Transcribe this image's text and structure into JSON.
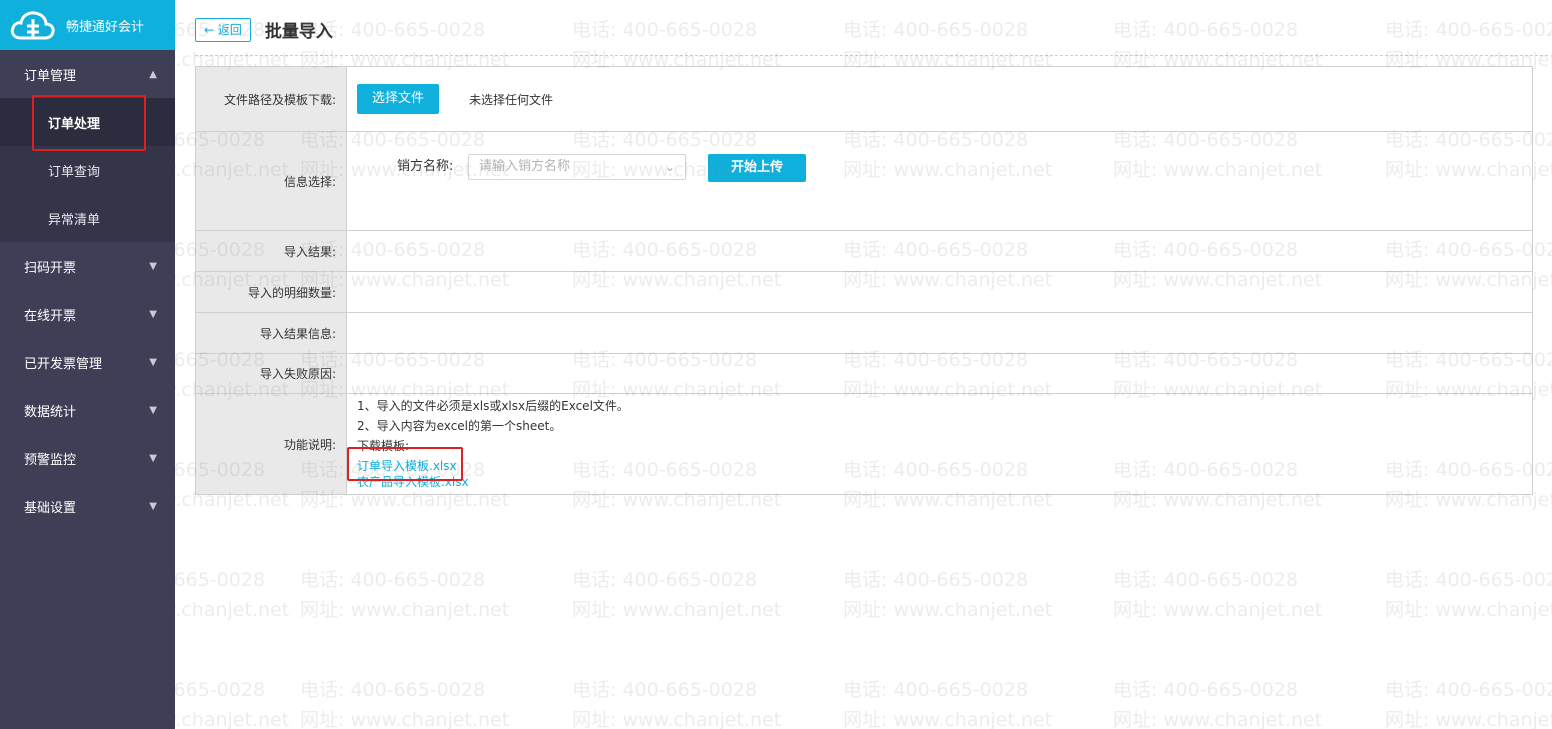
{
  "brand": {
    "name": "畅捷通好会计",
    "logo_icon": "cloud-logo-icon"
  },
  "sidebar": {
    "order_group": {
      "label": "订单管理",
      "expanded": true,
      "items": [
        {
          "label": "订单处理",
          "active": true
        },
        {
          "label": "订单查询",
          "active": false
        },
        {
          "label": "异常清单",
          "active": false
        }
      ]
    },
    "groups": [
      {
        "label": "扫码开票"
      },
      {
        "label": "在线开票"
      },
      {
        "label": "已开发票管理"
      },
      {
        "label": "数据统计"
      },
      {
        "label": "预警监控"
      },
      {
        "label": "基础设置"
      }
    ]
  },
  "header": {
    "back_label": "返回",
    "title": "批量导入"
  },
  "form": {
    "file_row": {
      "label": "文件路径及模板下载:",
      "choose_button": "选择文件",
      "no_file_text": "未选择任何文件"
    },
    "info_row": {
      "label": "信息选择:",
      "seller_label": "销方名称:",
      "seller_placeholder": "请输入销方名称",
      "upload_button": "开始上传"
    },
    "result_label": "导入结果:",
    "detail_count_label": "导入的明细数量:",
    "result_info_label": "导入结果信息:",
    "fail_reason_label": "导入失败原因:",
    "description": {
      "label": "功能说明:",
      "line1": "1、导入的文件必须是xls或xlsx后缀的Excel文件。",
      "line2": "2、导入内容为excel的第一个sheet。",
      "line3": "下载模板:",
      "template_order": "订单导入模板.xlsx",
      "template_product": "农产品导入模板.xlsx"
    }
  },
  "watermark": {
    "line1": "电话: 400-665-0028",
    "line2": "网址: www.chanjet.net"
  },
  "colors": {
    "sidebar_bg": "#3e3f56",
    "brand_bg": "#0fb0dc",
    "accent": "#0fb0dc",
    "highlight": "#e02020"
  }
}
